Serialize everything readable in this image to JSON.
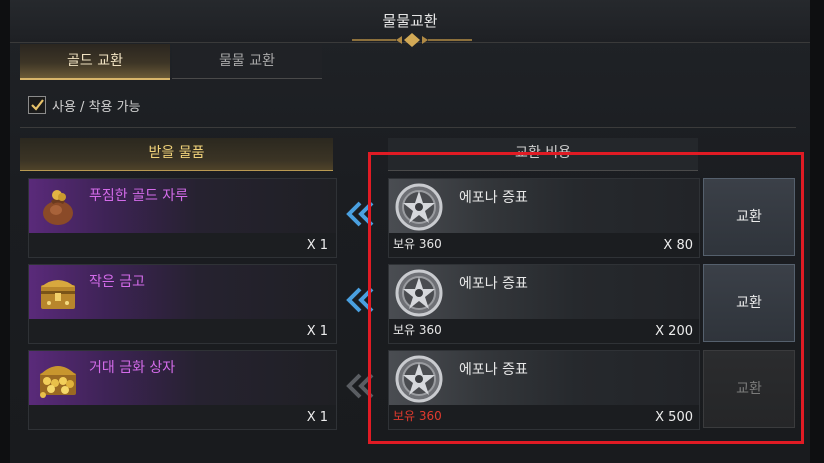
{
  "window": {
    "title": "물물교환"
  },
  "tabs": [
    {
      "label": "골드 교환",
      "active": true
    },
    {
      "label": "물물 교환",
      "active": false
    }
  ],
  "filter": {
    "label": "사용 / 착용 가능",
    "checked": true
  },
  "headers": {
    "receive": "받을 물품",
    "cost": "교환 비용"
  },
  "rows": [
    {
      "receive": {
        "name": "푸짐한 골드 자루",
        "qty": "X 1",
        "icon": "gold-pouch-icon"
      },
      "cost": {
        "name": "에포나 증표",
        "owned": "보유 360",
        "qty": "X 80",
        "icon": "epona-token-icon",
        "sufficient": true
      },
      "button": {
        "label": "교환",
        "enabled": true
      }
    },
    {
      "receive": {
        "name": "작은 금고",
        "qty": "X 1",
        "icon": "small-treasure-chest-icon"
      },
      "cost": {
        "name": "에포나 증표",
        "owned": "보유 360",
        "qty": "X 200",
        "icon": "epona-token-icon",
        "sufficient": true
      },
      "button": {
        "label": "교환",
        "enabled": true
      }
    },
    {
      "receive": {
        "name": "거대 금화 상자",
        "qty": "X 1",
        "icon": "large-gold-coin-chest-icon"
      },
      "cost": {
        "name": "에포나 증표",
        "owned": "보유 360",
        "qty": "X 500",
        "icon": "epona-token-icon",
        "sufficient": false
      },
      "button": {
        "label": "교환",
        "enabled": false
      }
    }
  ],
  "colors": {
    "item_name_purple": "#d36be9",
    "gold_header": "#f0d27a",
    "insufficient_red": "#e03a2e",
    "highlight_red": "#e01b24"
  }
}
